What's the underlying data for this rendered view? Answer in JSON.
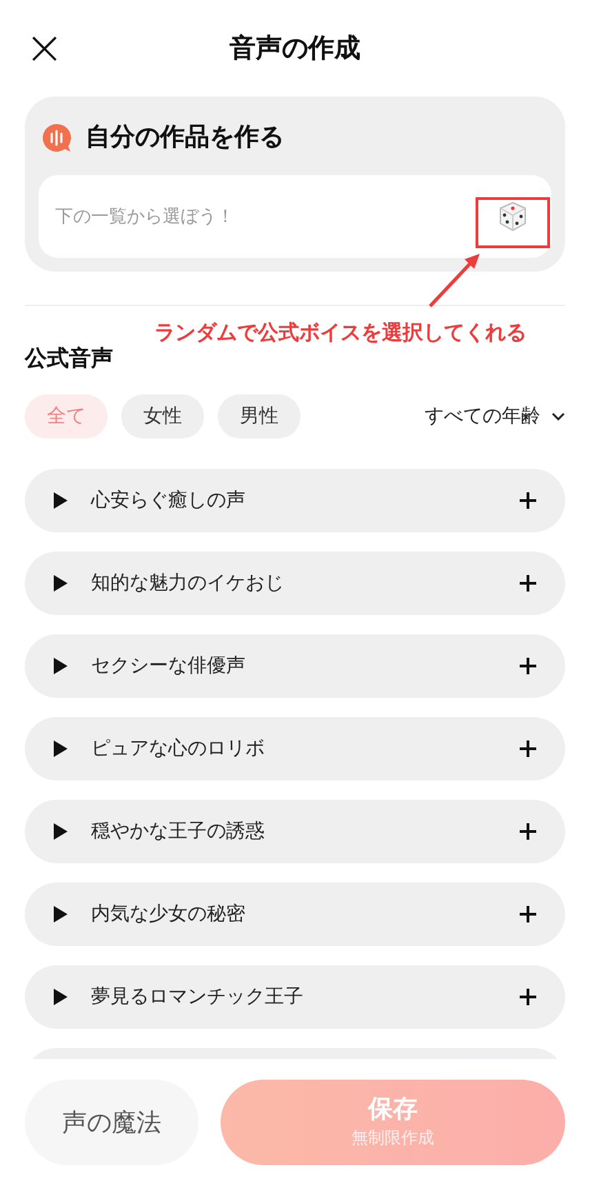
{
  "header": {
    "close": "×",
    "title": "音声の作成"
  },
  "create_card": {
    "title": "自分の作品を作る",
    "input": {
      "placeholder": "下の一覧から選ぼう！"
    }
  },
  "annotation": {
    "text": "ランダムで公式ボイスを選択してくれる"
  },
  "section_title": "公式音声",
  "filters": [
    {
      "label": "全て",
      "selected": true
    },
    {
      "label": "女性",
      "selected": false
    },
    {
      "label": "男性",
      "selected": false
    }
  ],
  "age_filter": "すべての年齢",
  "voices": [
    {
      "name": "心安らぐ癒しの声"
    },
    {
      "name": "知的な魅力のイケおじ"
    },
    {
      "name": "セクシーな俳優声"
    },
    {
      "name": "ピュアな心のロリボ"
    },
    {
      "name": "穏やかな王子の誘惑"
    },
    {
      "name": "内気な少女の秘密"
    },
    {
      "name": "夢見るロマンチック王子"
    }
  ],
  "bottom_bar": {
    "magic_button": "声の魔法",
    "save_button": {
      "label": "保存",
      "sublabel": "無制限作成"
    }
  }
}
